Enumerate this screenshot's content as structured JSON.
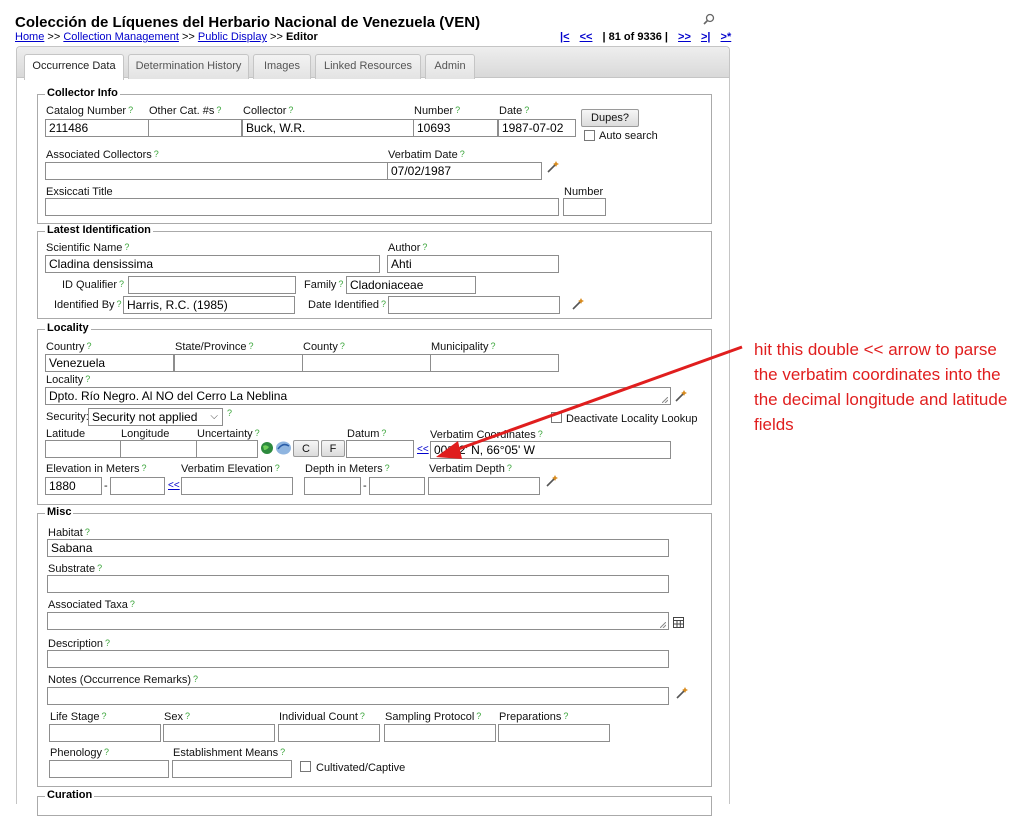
{
  "header": {
    "title": "Colección de Líquenes del Herbario Nacional de Venezuela (VEN)",
    "crumb_home": "Home",
    "crumb_sep": ">>",
    "crumb_collection": "Collection Management",
    "crumb_public": "Public Display",
    "crumb_editor": "Editor",
    "nav_first": "|<",
    "nav_prev": "<<",
    "nav_status": "| 81 of 9336 |",
    "nav_next": ">>",
    "nav_last": ">|",
    "nav_new": ">*"
  },
  "tabs": [
    "Occurrence Data",
    "Determination History",
    "Images",
    "Linked Resources",
    "Admin"
  ],
  "collector_info": {
    "legend": "Collector Info",
    "catalog_label": "Catalog Number",
    "catalog_value": "211486",
    "othercat_label": "Other Cat. #s",
    "othercat_value": "",
    "collector_label": "Collector",
    "collector_value": "Buck, W.R.",
    "number_label": "Number",
    "number_value": "10693",
    "date_label": "Date",
    "date_value": "1987-07-02",
    "dupes_label": "Dupes?",
    "auto_search_label": "Auto search",
    "assoc_label": "Associated Collectors",
    "assoc_value": "",
    "verbatim_date_label": "Verbatim Date",
    "verbatim_date_value": "07/02/1987",
    "exsiccati_label": "Exsiccati Title",
    "exsiccati_value": "",
    "exs_number_label": "Number",
    "exs_number_value": ""
  },
  "identification": {
    "legend": "Latest Identification",
    "sciname_label": "Scientific Name",
    "sciname_value": "Cladina densissima",
    "author_label": "Author",
    "author_value": "Ahti",
    "idq_label": "ID Qualifier",
    "idq_value": "",
    "family_label": "Family",
    "family_value": "Cladoniaceae",
    "idby_label": "Identified By",
    "idby_value": "Harris, R.C. (1985)",
    "dateid_label": "Date Identified",
    "dateid_value": ""
  },
  "locality": {
    "legend": "Locality",
    "country_label": "Country",
    "country_value": "Venezuela",
    "state_label": "State/Province",
    "state_value": "",
    "county_label": "County",
    "county_value": "",
    "municipality_label": "Municipality",
    "municipality_value": "",
    "locality_label": "Locality",
    "locality_value": "Dpto. Río Negro. Al NO del Cerro La Neblina",
    "security_label": "Security:",
    "security_value": "Security not applied",
    "deactivate_label": "Deactivate Locality Lookup",
    "lat_label": "Latitude",
    "lat_value": "",
    "lon_label": "Longitude",
    "lon_value": "",
    "unc_label": "Uncertainty",
    "unc_value": "",
    "c_button": "C",
    "f_button": "F",
    "datum_label": "Datum",
    "datum_value": "",
    "parse_link": "<<",
    "vcoords_label": "Verbatim Coordinates",
    "vcoords_value": "00°52' N, 66°05' W",
    "elev_label": "Elevation in Meters",
    "elev_min": "1880",
    "dash": "-",
    "elev_max": "",
    "elev_parse": "<<",
    "velev_label": "Verbatim Elevation",
    "velev_value": "",
    "depth_label": "Depth in Meters",
    "depth_min": "",
    "depth_max": "",
    "vdepth_label": "Verbatim Depth",
    "vdepth_value": ""
  },
  "misc": {
    "legend": "Misc",
    "habitat_label": "Habitat",
    "habitat_value": "Sabana",
    "substrate_label": "Substrate",
    "substrate_value": "",
    "assoc_taxa_label": "Associated Taxa",
    "assoc_taxa_value": "",
    "desc_label": "Description",
    "desc_value": "",
    "notes_label": "Notes (Occurrence Remarks)",
    "notes_value": "",
    "lifestage_label": "Life Stage",
    "sex_label": "Sex",
    "indcount_label": "Individual Count",
    "sampling_label": "Sampling Protocol",
    "preparations_label": "Preparations",
    "phenology_label": "Phenology",
    "estab_label": "Establishment Means",
    "cultivated_label": "Cultivated/Captive"
  },
  "curation": {
    "legend": "Curation"
  },
  "annotation": {
    "text": "hit this double << arrow to parse the verbatim coordinates into the the decimal longitude and latitude fields",
    "color": "#e01e1e"
  }
}
